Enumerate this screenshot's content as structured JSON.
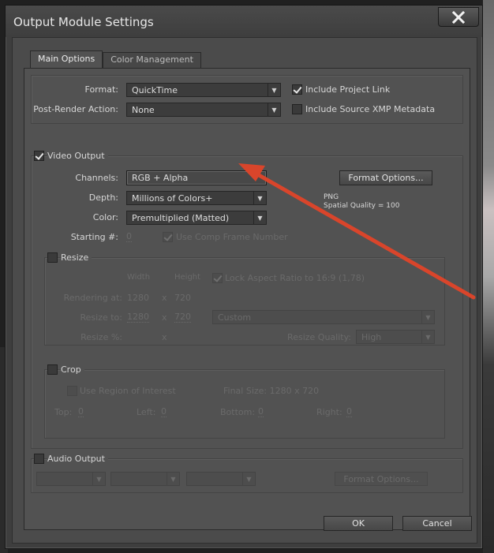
{
  "window": {
    "title": "Output Module Settings"
  },
  "tabs": [
    {
      "label": "Main Options",
      "active": true
    },
    {
      "label": "Color Management",
      "active": false
    }
  ],
  "format": {
    "format_label": "Format:",
    "format_value": "QuickTime",
    "post_render_label": "Post-Render Action:",
    "post_render_value": "None",
    "include_project_link": {
      "label": "Include Project Link",
      "checked": true
    },
    "include_xmp": {
      "label": "Include Source XMP Metadata",
      "checked": false
    }
  },
  "video": {
    "title": "Video Output",
    "enabled": true,
    "channels_label": "Channels:",
    "channels_value": "RGB + Alpha",
    "depth_label": "Depth:",
    "depth_value": "Millions of Colors+",
    "color_label": "Color:",
    "color_value": "Premultiplied (Matted)",
    "starting_label": "Starting #:",
    "starting_value": "0",
    "use_comp_frame": {
      "label": "Use Comp Frame Number",
      "checked": true,
      "disabled": true
    },
    "format_options_label": "Format Options...",
    "codec_line1": "PNG",
    "codec_line2": "Spatial Quality = 100"
  },
  "resize": {
    "title": "Resize",
    "enabled": false,
    "width_header": "Width",
    "height_header": "Height",
    "lock_aspect": {
      "label": "Lock Aspect Ratio to 16:9 (1,78)",
      "checked": true
    },
    "rendering_at_label": "Rendering at:",
    "rendering_w": "1280",
    "rendering_x": "x",
    "rendering_h": "720",
    "resize_to_label": "Resize to:",
    "resize_to_w": "1280",
    "resize_to_x": "x",
    "resize_to_h": "720",
    "preset_value": "Custom",
    "resize_pct_label": "Resize %:",
    "resize_pct_x": "x",
    "quality_label": "Resize Quality:",
    "quality_value": "High"
  },
  "crop": {
    "title": "Crop",
    "enabled": false,
    "use_roi": {
      "label": "Use Region of Interest",
      "checked": false
    },
    "final_size": "Final Size: 1280 x 720",
    "top_label": "Top:",
    "top_value": "0",
    "left_label": "Left:",
    "left_value": "0",
    "bottom_label": "Bottom:",
    "bottom_value": "0",
    "right_label": "Right:",
    "right_value": "0"
  },
  "audio": {
    "title": "Audio Output",
    "enabled": false,
    "format_options_label": "Format Options..."
  },
  "footer": {
    "ok_label": "OK",
    "cancel_label": "Cancel"
  },
  "annotation": {
    "arrow_color": "#d9452b"
  }
}
